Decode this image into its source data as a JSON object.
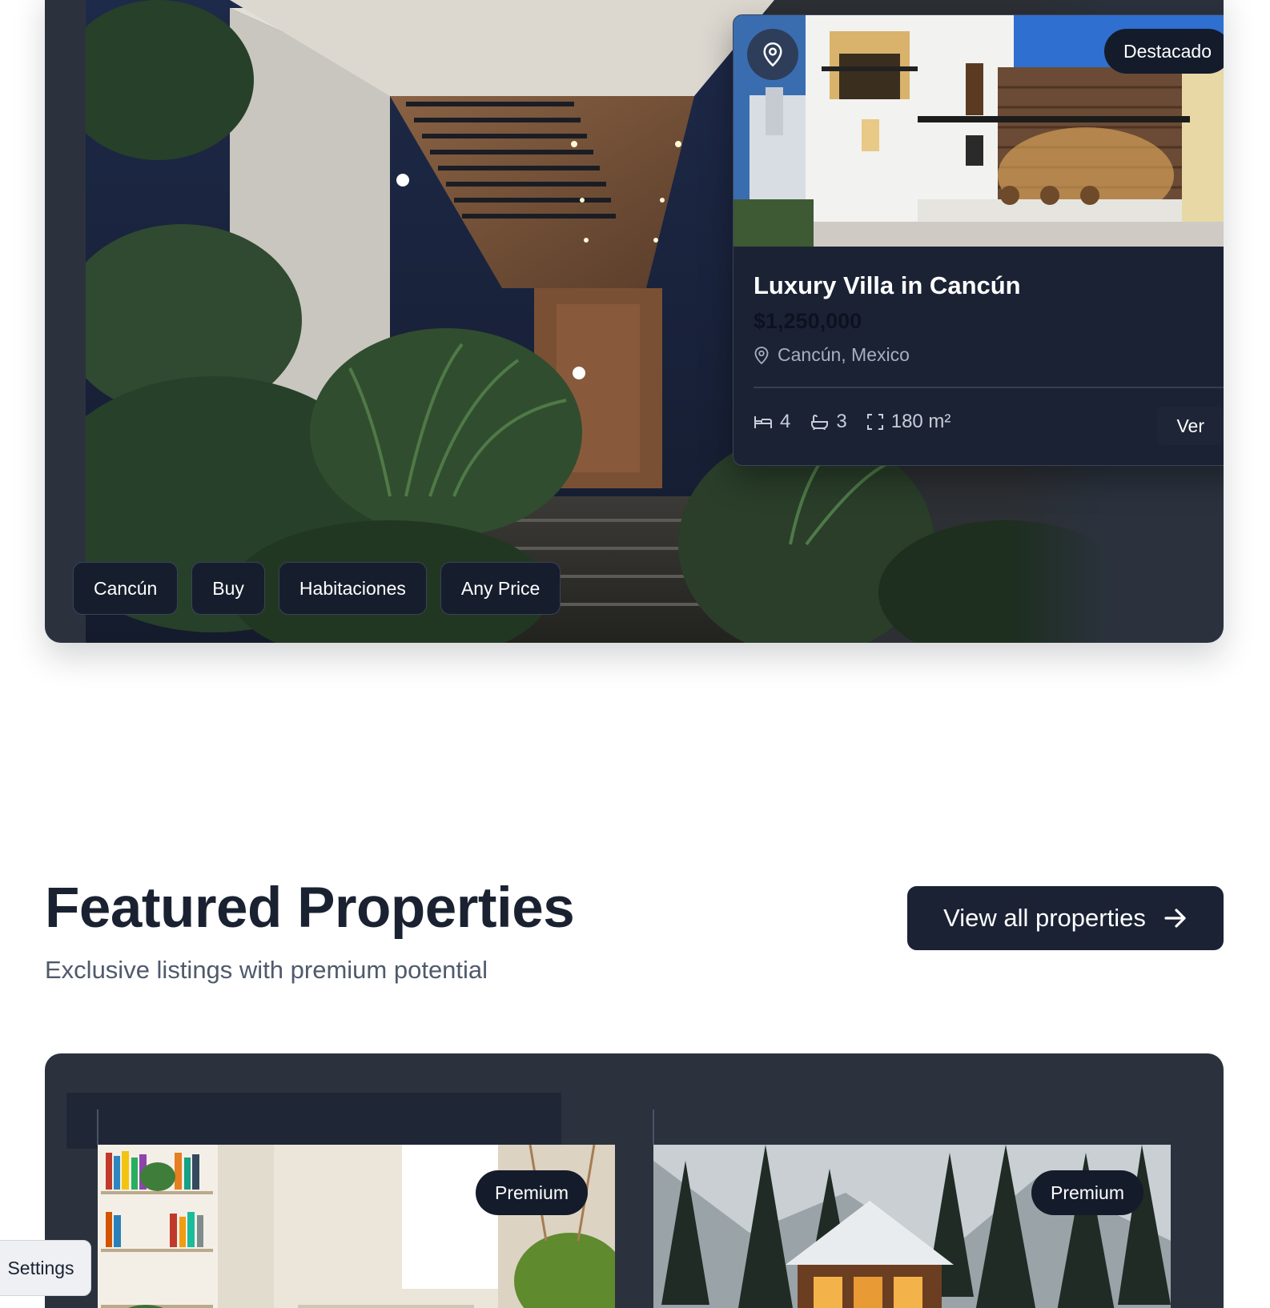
{
  "hero": {
    "listing": {
      "badge": "Destacado",
      "title": "Luxury Villa in Cancún",
      "price": "$1,250,000",
      "location": "Cancún, Mexico",
      "beds": "4",
      "baths": "3",
      "area": "180 m²",
      "view_label": "Ver"
    },
    "chips": [
      "Cancún",
      "Buy",
      "Habitaciones",
      "Any Price"
    ]
  },
  "featured": {
    "title": "Featured Properties",
    "subtitle": "Exclusive listings with premium potential",
    "view_all_label": "View all properties",
    "cards": [
      {
        "badge": "Premium"
      },
      {
        "badge": "Premium"
      }
    ]
  },
  "settings_label": "Settings",
  "colors": {
    "navy": "#1b2234",
    "panel": "#2b323e",
    "text_dark": "#1a2232",
    "text_muted": "#4f5a6b"
  },
  "icons": [
    "map-pin-icon",
    "bed-icon",
    "bath-icon",
    "area-icon",
    "arrow-right-icon"
  ]
}
